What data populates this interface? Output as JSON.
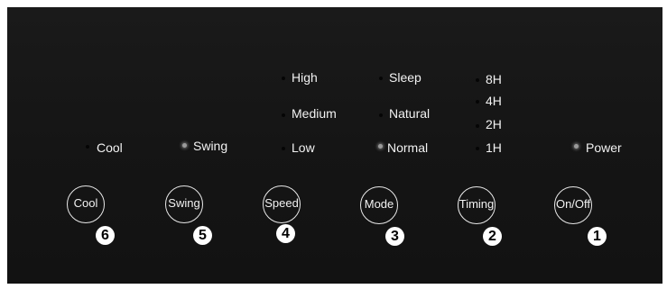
{
  "indicators": {
    "cool": {
      "label": "Cool",
      "lit": false
    },
    "swing": {
      "label": "Swing",
      "lit": true
    },
    "speed": [
      {
        "label": "High",
        "lit": false
      },
      {
        "label": "Medium",
        "lit": false
      },
      {
        "label": "Low",
        "lit": false
      }
    ],
    "mode": [
      {
        "label": "Sleep",
        "lit": false
      },
      {
        "label": "Natural",
        "lit": false
      },
      {
        "label": "Normal",
        "lit": true
      }
    ],
    "timing": [
      {
        "label": "8H",
        "lit": false
      },
      {
        "label": "4H",
        "lit": false
      },
      {
        "label": "2H",
        "lit": false
      },
      {
        "label": "1H",
        "lit": false
      }
    ],
    "power": {
      "label": "Power",
      "lit": true
    }
  },
  "buttons": [
    {
      "label": "Cool",
      "number": "6"
    },
    {
      "label": "Swing",
      "number": "5"
    },
    {
      "label": "Speed",
      "number": "4"
    },
    {
      "label": "Mode",
      "number": "3"
    },
    {
      "label": "Timing",
      "number": "2"
    },
    {
      "label": "On/Off",
      "number": "1"
    }
  ],
  "colors": {
    "panel": "#161616",
    "text": "#f2f2f2",
    "lit_indicator": "#9a9a9a",
    "badge": "#ffffff"
  }
}
